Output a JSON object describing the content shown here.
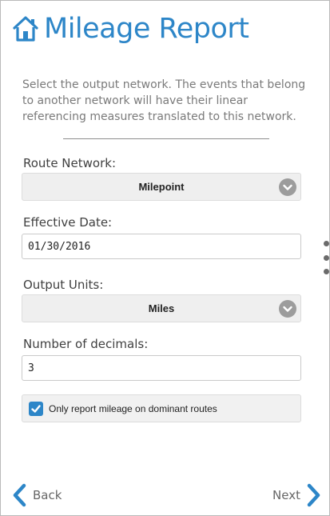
{
  "header": {
    "title": "Mileage Report",
    "icon": "home-icon",
    "accent_color": "#2d86c8"
  },
  "description": "Select the output network. The events that belong to another network will have their linear referencing measures translated to this network.",
  "form": {
    "route_network": {
      "label": "Route Network:",
      "value": "Milepoint"
    },
    "effective_date": {
      "label": "Effective Date:",
      "value": "01/30/2016"
    },
    "output_units": {
      "label": "Output Units:",
      "value": "Miles"
    },
    "decimals": {
      "label": "Number of decimals:",
      "value": "3"
    },
    "dominant_routes": {
      "label": "Only report mileage on dominant routes",
      "checked": true
    }
  },
  "nav": {
    "back_label": "Back",
    "next_label": "Next"
  }
}
